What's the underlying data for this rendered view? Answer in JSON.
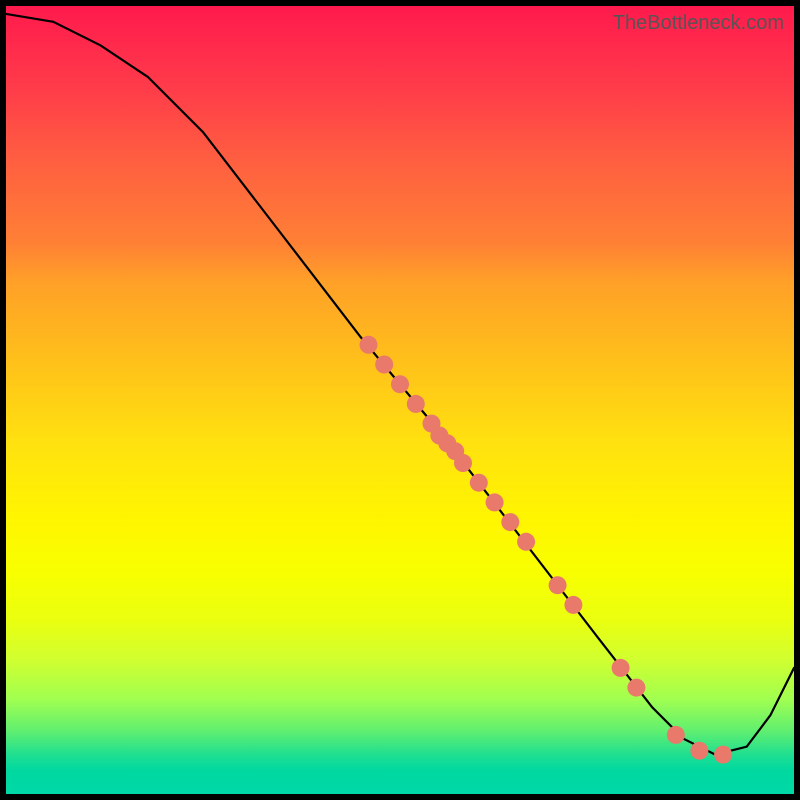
{
  "credit": "TheBottleneck.com",
  "chart_data": {
    "type": "line",
    "title": "",
    "xlabel": "",
    "ylabel": "",
    "xlim": [
      0,
      100
    ],
    "ylim": [
      0,
      100
    ],
    "note": "Axes are unlabeled in the source image; values are estimated on a 0–100 normalized scale from pixel positions. Line descends from top-left, flattens near x≈85–90, then rises toward the right edge.",
    "series": [
      {
        "name": "curve",
        "x": [
          0,
          6,
          12,
          18,
          25,
          35,
          45,
          55,
          65,
          75,
          82,
          86,
          90,
          94,
          97,
          100
        ],
        "y": [
          99,
          98,
          95,
          91,
          84,
          71,
          58,
          46,
          33,
          20,
          11,
          7,
          5,
          6,
          10,
          16
        ]
      }
    ],
    "highlighted_points": {
      "name": "dots",
      "note": "Clustered points along the middle-lower segment of the curve and a few near the trough.",
      "x": [
        46,
        48,
        50,
        52,
        54,
        55,
        56,
        57,
        58,
        60,
        62,
        64,
        66,
        70,
        72,
        78,
        80,
        85,
        88,
        91
      ],
      "y": [
        57,
        54.5,
        52,
        49.5,
        47,
        45.5,
        44.5,
        43.5,
        42,
        39.5,
        37,
        34.5,
        32,
        26.5,
        24,
        16,
        13.5,
        7.5,
        5.5,
        5
      ]
    }
  }
}
